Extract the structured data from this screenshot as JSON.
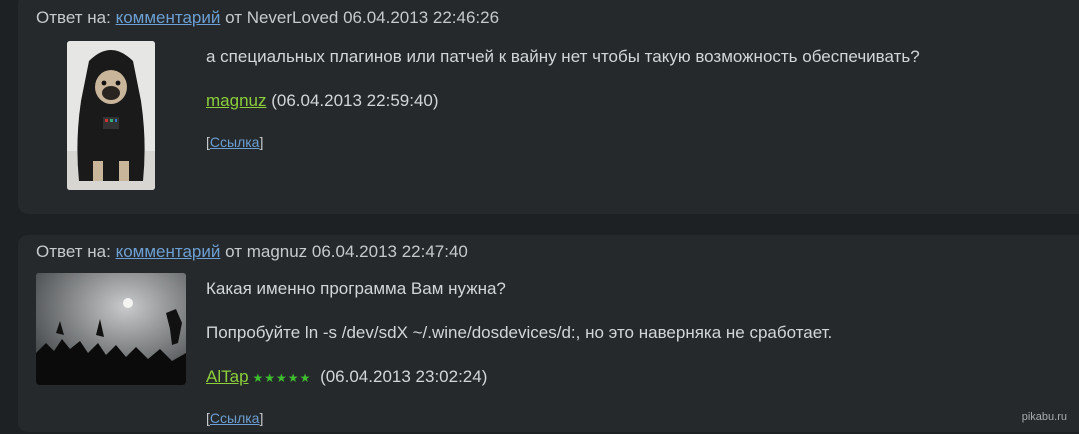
{
  "comments": [
    {
      "reply_prefix": "Ответ на:",
      "reply_link": "комментарий",
      "reply_suffix": "от NeverLoved 06.04.2013 22:46:26",
      "lines": [
        "а специальных плагинов или патчей к вайну нет чтобы такую возможность обеспечивать?"
      ],
      "user": "magnuz",
      "stars": "",
      "time": "(06.04.2013 22:59:40)",
      "ref_label": "Ссылка"
    },
    {
      "reply_prefix": "Ответ на:",
      "reply_link": "комментарий",
      "reply_suffix": "от magnuz 06.04.2013 22:47:40",
      "lines": [
        "Какая именно программа Вам нужна?",
        "Попробуйте ln -s /dev/sdX ~/.wine/dosdevices/d:, но это наверняка не сработает."
      ],
      "user": "AlTap",
      "stars": "★★★★★",
      "time": "(06.04.2013 23:02:24)",
      "ref_label": "Ссылка"
    }
  ],
  "watermark": "pikabu.ru"
}
